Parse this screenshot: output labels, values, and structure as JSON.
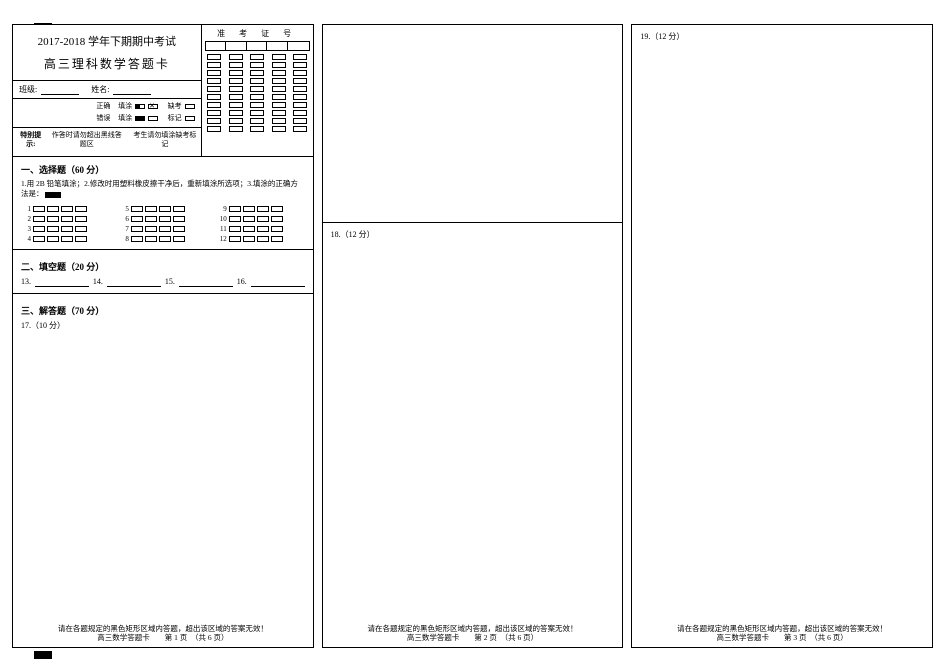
{
  "header": {
    "title_line1": "2017-2018 学年下期期中考试",
    "title_line2": "高三理科数学答题卡"
  },
  "student_info": {
    "class_label": "班级:",
    "name_label": "姓名:",
    "correct_label": "正确",
    "fill_label": "填涂",
    "error_label": "错误",
    "fill_label2": "填涂",
    "absent_label": "缺考",
    "mark_label": "标记"
  },
  "notice": {
    "title": "特别提示:",
    "l1": "作答时请勿超出黑线答题区",
    "l2": "考生请勿填涂缺考标记"
  },
  "exam_id": {
    "title": "准 考 证 号"
  },
  "sec1": {
    "title": "一、选择题（60 分）",
    "instr": "1.用 2B 铅笔填涂；2.修改时用塑料橡皮擦干净后，重新填涂所选项；3.填涂的正确方法是：",
    "q_numbers": [
      "1",
      "2",
      "3",
      "4",
      "5",
      "6",
      "7",
      "8",
      "9",
      "10",
      "11",
      "12"
    ]
  },
  "sec2": {
    "title": "二、填空题（20 分）",
    "nums": [
      "13.",
      "14.",
      "15.",
      "16."
    ]
  },
  "sec3": {
    "title": "三、解答题（70 分）",
    "q17": "17.（10 分）"
  },
  "page2": {
    "q18": "18.（12 分）"
  },
  "page3": {
    "q19": "19.（12 分）"
  },
  "footer": {
    "warn": "请在各题规定的黑色矩形区域内答题，超出该区域的答案无效！",
    "p1": "高三数学答题卡　　第 1 页　（共 6 页）",
    "p2": "高三数学答题卡　　第 2 页　（共 6 页）",
    "p3": "高三数学答题卡　　第 3 页　（共 6 页）"
  }
}
